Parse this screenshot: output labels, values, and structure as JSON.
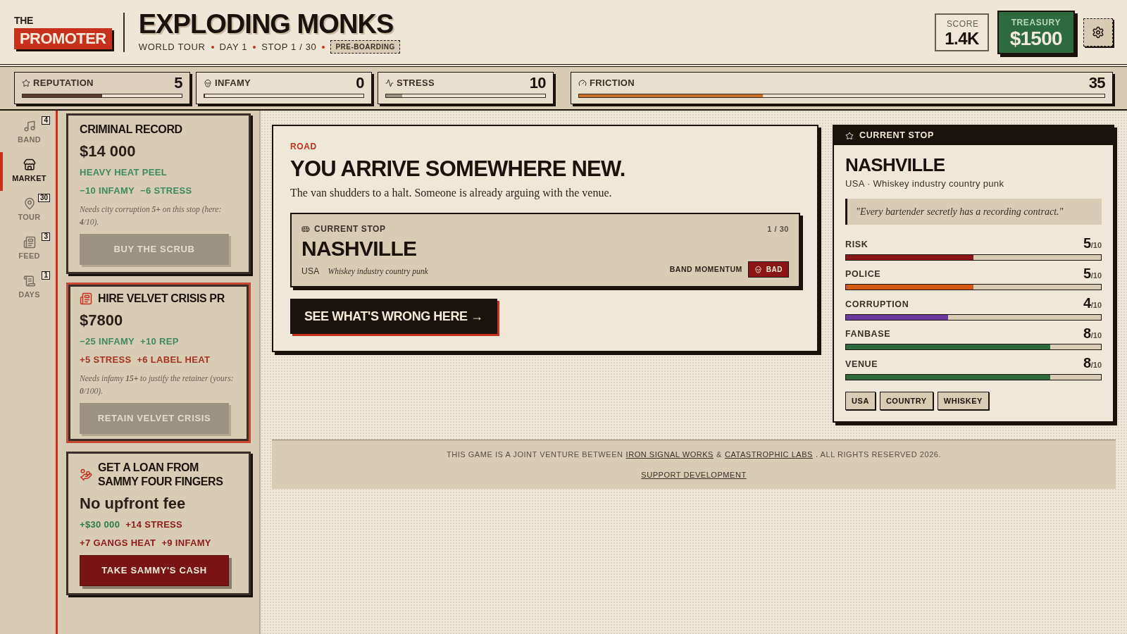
{
  "header": {
    "brand_top": "THE",
    "brand_name": "PROMOTER",
    "band_name": "EXPLODING MONKS",
    "meta": [
      "WORLD TOUR",
      "DAY 1",
      "STOP 1 / 30"
    ],
    "phase": "PRE-BOARDING",
    "score": {
      "label": "SCORE",
      "value": "1.4K"
    },
    "treasury": {
      "label": "TREASURY",
      "value": "$1500"
    }
  },
  "stats": [
    {
      "label": "REPUTATION",
      "value": "5",
      "level": 0.5,
      "color": "#5a3d28"
    },
    {
      "label": "INFAMY",
      "value": "0",
      "level": 0
    },
    {
      "label": "STRESS",
      "value": "10",
      "level": 0.1,
      "color": "#9a9282"
    },
    {
      "label": "FRICTION",
      "value": "35",
      "level": 0.35,
      "color": "#c8702a"
    }
  ],
  "nav": [
    {
      "label": "BAND",
      "count": "4",
      "selected": false
    },
    {
      "label": "MARKET",
      "selected": true
    },
    {
      "label": "TOUR",
      "count": "30",
      "selected": false
    },
    {
      "label": "FEED",
      "count": "3",
      "selected": false
    },
    {
      "label": "DAYS",
      "count": "1",
      "selected": false
    }
  ],
  "market": [
    {
      "title": "CRIMINAL RECORD",
      "price": "$14 000",
      "highlighted": false,
      "effects": [
        [
          {
            "text": "HEAVY HEAT PEEL",
            "color": "#3f8a5a"
          }
        ],
        [
          {
            "text": "−10 INFAMY",
            "color": "#3f8a5a"
          },
          {
            "text": "−6 STRESS",
            "color": "#3f8a5a"
          }
        ]
      ],
      "note": "Needs city corruption **5+** on this stop (here: **4**/10).",
      "button": {
        "label": "BUY THE SCRUB",
        "disabled": true
      }
    },
    {
      "title": "HIRE VELVET CRISIS PR",
      "price": "$7800",
      "highlighted": true,
      "effects": [
        [
          {
            "text": "−25 INFAMY",
            "color": "#3f8a5a"
          },
          {
            "text": "+10 REP",
            "color": "#3f8a5a"
          }
        ],
        [
          {
            "text": "+5 STRESS",
            "color": "#a8321f"
          },
          {
            "text": "+6 LABEL HEAT",
            "color": "#a8321f"
          }
        ]
      ],
      "note": "Needs infamy **15+** to justify the retainer (yours: **0**/100).",
      "button": {
        "label": "RETAIN VELVET CRISIS",
        "disabled": true
      }
    },
    {
      "title": "GET A LOAN FROM SAMMY FOUR FINGERS",
      "price": "No upfront fee",
      "highlighted": false,
      "effects": [
        [
          {
            "text": "+$30 000",
            "color": "#2f7a4a"
          },
          {
            "text": "+14 STRESS",
            "color": "#8c1a1a"
          }
        ],
        [
          {
            "text": "+7 GANGS HEAT",
            "color": "#8c1a1a"
          },
          {
            "text": "+9 INFAMY",
            "color": "#8c1a1a"
          }
        ]
      ],
      "button": {
        "label": "TAKE SAMMY'S CASH",
        "disabled": false
      }
    }
  ],
  "event": {
    "tag": "ROAD",
    "heading": "YOU ARRIVE SOMEWHERE NEW.",
    "text": "The van shudders to a halt. Someone is already arguing with the venue.",
    "stop": {
      "label": "CURRENT STOP",
      "counter": "1 / 30",
      "city": "NASHVILLE",
      "country": "USA",
      "description": "Whiskey industry country punk",
      "momentum_label": "BAND MOMENTUM",
      "momentum": "BAD"
    },
    "action": "SEE WHAT'S WRONG HERE →"
  },
  "panel": {
    "title": "CURRENT STOP",
    "city": "NASHVILLE",
    "subtitle": "USA · Whiskey industry country punk",
    "quote": "\"Every bartender secretly has a recording contract.\"",
    "meters": [
      {
        "label": "RISK",
        "value": "5",
        "max": "/10",
        "level": 0.5,
        "color": "#8c1515"
      },
      {
        "label": "POLICE",
        "value": "5",
        "max": "/10",
        "level": 0.5,
        "color": "#d35a14"
      },
      {
        "label": "CORRUPTION",
        "value": "4",
        "max": "/10",
        "level": 0.4,
        "color": "#6a3a9e"
      },
      {
        "label": "FANBASE",
        "value": "8",
        "max": "/10",
        "level": 0.8,
        "color": "#2d6a3e"
      },
      {
        "label": "VENUE",
        "value": "8",
        "max": "/10",
        "level": 0.8,
        "color": "#2d6a3e"
      }
    ],
    "tags": [
      "USA",
      "COUNTRY",
      "WHISKEY"
    ]
  },
  "footer": {
    "credits": [
      {
        "text": "THIS GAME IS A JOINT VENTURE BETWEEN",
        "link": false
      },
      {
        "text": "IRON SIGNAL WORKS",
        "link": true
      },
      {
        "text": "&",
        "link": false
      },
      {
        "text": "CATASTROPHIC LABS",
        "link": true
      },
      {
        "text": ". ALL RIGHTS RESERVED 2026.",
        "link": false
      }
    ],
    "support": "SUPPORT DEVELOPMENT"
  }
}
